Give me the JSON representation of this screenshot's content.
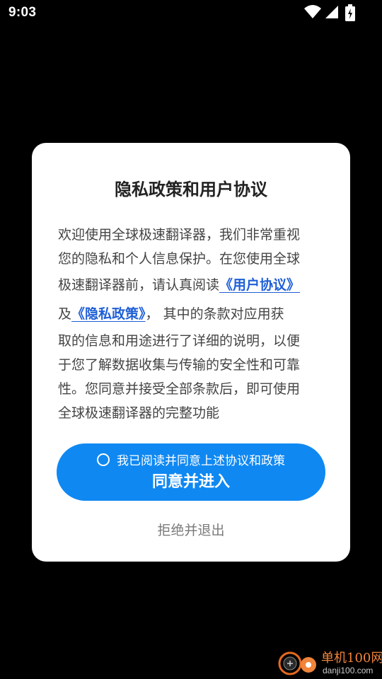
{
  "status_bar": {
    "time": "9:03",
    "icons": [
      "wifi-icon",
      "cellular-signal-icon",
      "battery-charging-icon"
    ]
  },
  "dialog": {
    "title": "隐私政策和用户协议",
    "body": {
      "line1": "欢迎使用全球极速翻译器，我们非常重视",
      "line2": "您的隐私和个人信息保护。在您使用全球",
      "line3_prefix": "极速翻译器前，请认真阅读",
      "user_agreement_link": "《用户协议》",
      "line4_prefix": "及",
      "privacy_policy_link": "《隐私政策》",
      "line4_suffix": "， 其中的条款对应用获",
      "line5": "取的信息和用途进行了详细的说明，以便",
      "line6": "于您了解数据收集与传输的安全性和可靠",
      "line7": "性。您同意并接受全部条款后，即可使用",
      "line8": "全球极速翻译器的完整功能"
    },
    "consent_text": "我已阅读并同意上述协议和政策",
    "consent_checked": false,
    "agree_button": "同意并进入",
    "reject_button": "拒绝并退出"
  },
  "watermark": {
    "name": "单机100网",
    "url": "danji100.com"
  },
  "colors": {
    "background": "#000000",
    "dialog": "#ffffff",
    "primary": "#0f88f2",
    "link": "#1f5fd6",
    "watermark_accent": "#f0843a"
  }
}
